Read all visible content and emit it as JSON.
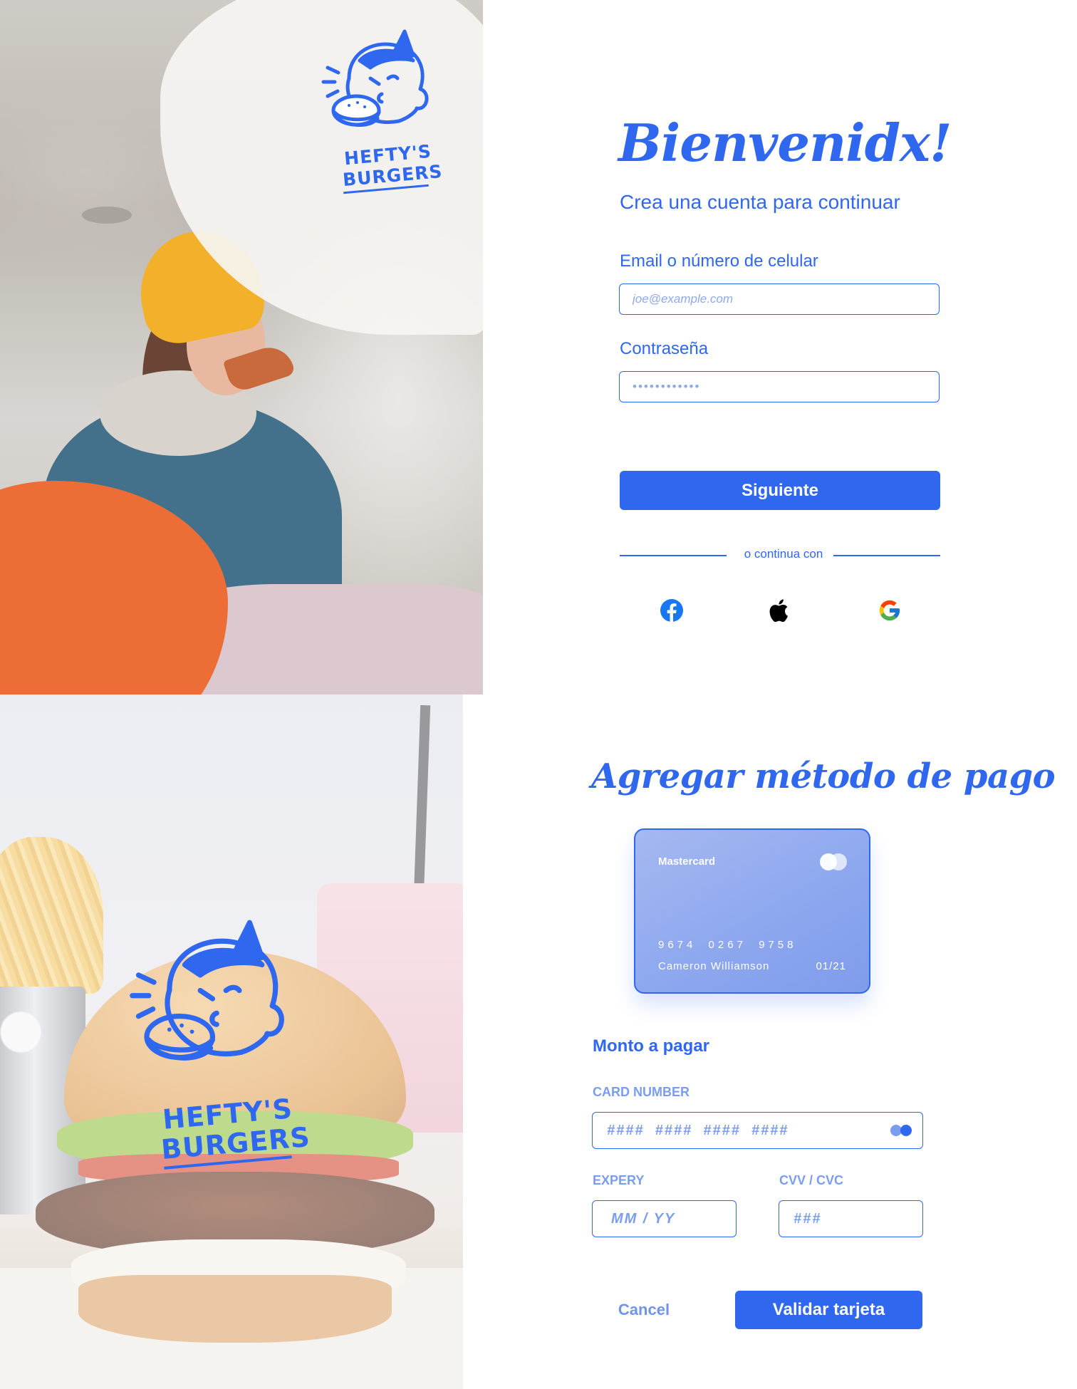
{
  "brand": {
    "line1": "HEFTY'S",
    "line2": "BURGERS"
  },
  "signup": {
    "title": "Bienvenidx!",
    "subtitle": "Crea una cuenta para continuar",
    "email_label": "Email o número de celular",
    "email_placeholder": "joe@example.com",
    "password_label": "Contraseña",
    "password_placeholder": "••••••••••••",
    "submit_label": "Siguiente",
    "divider_text": "o continua con",
    "social": [
      "facebook-icon",
      "apple-icon",
      "google-icon"
    ]
  },
  "payment": {
    "title": "Agregar método de pago",
    "card": {
      "brand": "Mastercard",
      "number": "9674 0267 9758",
      "holder": "Cameron Williamson",
      "expiry": "01/21"
    },
    "amount_label": "Monto a pagar",
    "card_number_label": "CARD NUMBER",
    "card_number_placeholder": "####  ####  ####  ####",
    "expiry_label": "EXPERY",
    "expiry_placeholder": "MM / YY",
    "cvv_label": "CVV / CVC",
    "cvv_placeholder": "###",
    "cancel_label": "Cancel",
    "validate_label": "Validar tarjeta"
  },
  "colors": {
    "primary": "#2f68ef",
    "accent_orange": "#ec6d35",
    "muted_blue": "#7b9df1"
  }
}
